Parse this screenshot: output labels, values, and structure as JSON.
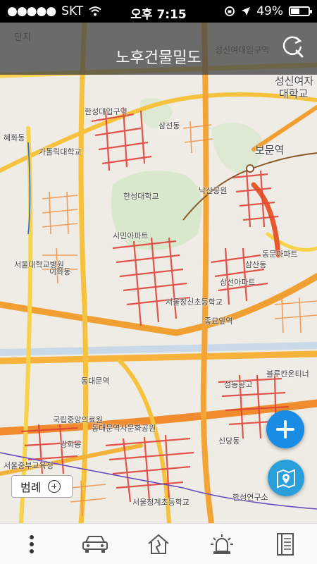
{
  "status_bar": {
    "carrier": "SKT",
    "time": "오후 7:15",
    "battery": "49%",
    "battery_level": 0.49
  },
  "header": {
    "title": "노후건물밀도",
    "refresh_icon": "refresh-search-icon"
  },
  "map": {
    "place_labels": [
      "단지",
      "성신여대입구역",
      "성신여자",
      "대학교",
      "한성대입구역",
      "삼선동",
      "보문역",
      "혜화동",
      "가톨릭대학교",
      "한성대학교",
      "서울대학교병원",
      "시민아파트",
      "동문아파트",
      "낙산공원",
      "서울창신초등학교",
      "종묘앞역",
      "삼선아파트",
      "이화동",
      "동대문역사문화공원",
      "동대문역",
      "성동공고",
      "블루칸온티너",
      "국립중앙의료원",
      "광희동",
      "서울중부교육청",
      "삼산동",
      "신당동",
      "서울청계초등학교",
      "한성연구소"
    ],
    "heat_colors": {
      "low": "#f5d34a",
      "mid": "#f59a2e",
      "high": "#e53a2e",
      "very_high": "#d21f3c"
    }
  },
  "controls": {
    "legend_label": "범례",
    "zoom_in_icon": "plus-icon",
    "map_layer_icon": "map-pin-icon"
  },
  "bottom_nav": {
    "items": [
      {
        "icon": "more-vertical-icon"
      },
      {
        "icon": "car-icon"
      },
      {
        "icon": "house-crack-icon"
      },
      {
        "icon": "siren-icon"
      },
      {
        "icon": "notebook-icon"
      }
    ]
  }
}
